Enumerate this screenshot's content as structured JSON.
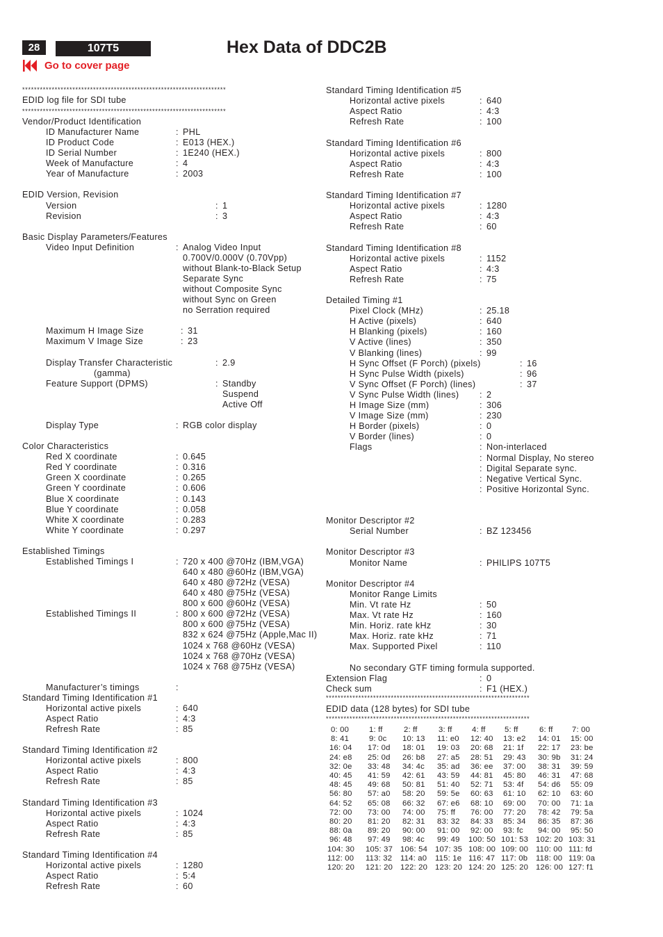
{
  "header": {
    "page_number": "28",
    "model": "107T5",
    "title": "Hex Data of DDC2B",
    "cover_link": "Go to cover page",
    "cover_icon": "rewind-to-start-icon",
    "accent_color": "#e31e24",
    "badge_color": "#231f20"
  },
  "divider": "*********************************************************************",
  "log_title": "EDID log file for SDI tube",
  "left_column": [
    {
      "type": "section",
      "text": "Vendor/Product Identification"
    },
    {
      "type": "field",
      "label": "ID Manufacturer Name",
      "value": "PHL"
    },
    {
      "type": "field",
      "label": "ID Product Code",
      "value": "E013 (HEX.)"
    },
    {
      "type": "field",
      "label": "ID Serial Number",
      "value": "1E240 (HEX.)"
    },
    {
      "type": "field",
      "label": "Week of Manufacture",
      "value": "4"
    },
    {
      "type": "field",
      "label": "Year of Manufacture",
      "value": "2003"
    },
    {
      "type": "blank"
    },
    {
      "type": "section",
      "text": "EDID Version, Revision"
    },
    {
      "type": "field",
      "label": "Version",
      "value": "1",
      "col": "wide"
    },
    {
      "type": "field",
      "label": "Revision",
      "value": "3",
      "col": "wide"
    },
    {
      "type": "blank"
    },
    {
      "type": "section",
      "text": "Basic Display Parameters/Features"
    },
    {
      "type": "field",
      "label": "Video Input Definition",
      "value": "Analog Video Input"
    },
    {
      "type": "cont",
      "value": "0.700V/0.000V (0.70Vpp)"
    },
    {
      "type": "cont",
      "value": "without Blank-to-Black Setup"
    },
    {
      "type": "cont",
      "value": "Separate Sync"
    },
    {
      "type": "cont",
      "value": "without Composite Sync"
    },
    {
      "type": "cont",
      "value": "without Sync on Green"
    },
    {
      "type": "cont",
      "value": "no Serration required"
    },
    {
      "type": "blank"
    },
    {
      "type": "field",
      "label": "Maximum H Image Size",
      "value": "31",
      "col": "mid"
    },
    {
      "type": "field",
      "label": "Maximum V Image Size",
      "value": "23",
      "col": "mid"
    },
    {
      "type": "blank"
    },
    {
      "type": "field",
      "label": "Display Transfer Characteristic",
      "value": "2.9",
      "col": "wide"
    },
    {
      "type": "sublabel",
      "text": "(gamma)"
    },
    {
      "type": "field",
      "label": "Feature Support (DPMS)",
      "value": "Standby",
      "col": "wide"
    },
    {
      "type": "cont",
      "value": "Suspend",
      "col": "wide"
    },
    {
      "type": "cont",
      "value": "Active Off",
      "col": "wide"
    },
    {
      "type": "blank"
    },
    {
      "type": "field",
      "label": "Display Type",
      "value": "RGB color display"
    },
    {
      "type": "blank"
    },
    {
      "type": "section",
      "text": "Color Characteristics"
    },
    {
      "type": "field",
      "label": "Red   X coordinate",
      "value": "0.645"
    },
    {
      "type": "field",
      "label": "Red   Y coordinate",
      "value": "0.316"
    },
    {
      "type": "field",
      "label": "Green X coordinate",
      "value": "0.265"
    },
    {
      "type": "field",
      "label": "Green Y coordinate",
      "value": "0.606"
    },
    {
      "type": "field",
      "label": "Blue  X coordinate",
      "value": "0.143"
    },
    {
      "type": "field",
      "label": "Blue  Y coordinate",
      "value": "0.058"
    },
    {
      "type": "field",
      "label": "White X coordinate",
      "value": "0.283"
    },
    {
      "type": "field",
      "label": "White Y coordinate",
      "value": "0.297"
    },
    {
      "type": "blank"
    },
    {
      "type": "section",
      "text": "Established Timings"
    },
    {
      "type": "field",
      "label": "Established Timings I",
      "value": "720 x 400 @70Hz (IBM,VGA)"
    },
    {
      "type": "cont",
      "value": "640 x 480 @60Hz (IBM,VGA)"
    },
    {
      "type": "cont",
      "value": "640 x 480 @72Hz (VESA)"
    },
    {
      "type": "cont",
      "value": "640 x 480 @75Hz (VESA)"
    },
    {
      "type": "cont",
      "value": "800 x 600 @60Hz (VESA)"
    },
    {
      "type": "field",
      "label": "Established Timings II",
      "value": "800 x 600 @72Hz (VESA)"
    },
    {
      "type": "cont",
      "value": "800 x 600 @75Hz (VESA)"
    },
    {
      "type": "cont",
      "value": "832 x 624 @75Hz (Apple,Mac II)"
    },
    {
      "type": "cont",
      "value": "1024 x 768 @60Hz (VESA)"
    },
    {
      "type": "cont",
      "value": "1024 x 768 @70Hz (VESA)"
    },
    {
      "type": "cont",
      "value": "1024 x 768 @75Hz (VESA)"
    },
    {
      "type": "blank"
    },
    {
      "type": "field",
      "label": "Manufacturer’s timings",
      "value": ""
    },
    {
      "type": "section",
      "text": "Standard Timing Identification #1"
    },
    {
      "type": "field",
      "label": "Horizontal active pixels",
      "value": "640"
    },
    {
      "type": "field",
      "label": "Aspect Ratio",
      "value": "4:3"
    },
    {
      "type": "field",
      "label": "Refresh Rate",
      "value": "85"
    },
    {
      "type": "blank"
    },
    {
      "type": "section",
      "text": "Standard Timing Identification #2"
    },
    {
      "type": "field",
      "label": "Horizontal active pixels",
      "value": "800"
    },
    {
      "type": "field",
      "label": "Aspect Ratio",
      "value": "4:3"
    },
    {
      "type": "field",
      "label": "Refresh Rate",
      "value": "85"
    },
    {
      "type": "blank"
    },
    {
      "type": "section",
      "text": "Standard Timing Identification #3"
    },
    {
      "type": "field",
      "label": "Horizontal active pixels",
      "value": "1024"
    },
    {
      "type": "field",
      "label": "Aspect Ratio",
      "value": "4:3"
    },
    {
      "type": "field",
      "label": "Refresh Rate",
      "value": "85"
    },
    {
      "type": "blank"
    },
    {
      "type": "section",
      "text": "Standard Timing Identification #4"
    },
    {
      "type": "field",
      "label": "Horizontal active pixels",
      "value": "1280"
    },
    {
      "type": "field",
      "label": "Aspect Ratio",
      "value": "5:4"
    },
    {
      "type": "field",
      "label": "Refresh Rate",
      "value": "60"
    }
  ],
  "right_column": [
    {
      "type": "section",
      "text": "Standard Timing Identification #5"
    },
    {
      "type": "field",
      "label": "Horizontal active pixels",
      "value": "640"
    },
    {
      "type": "field",
      "label": "Aspect Ratio",
      "value": "4:3"
    },
    {
      "type": "field",
      "label": "Refresh Rate",
      "value": "100"
    },
    {
      "type": "blank"
    },
    {
      "type": "section",
      "text": "Standard Timing Identification #6"
    },
    {
      "type": "field",
      "label": "Horizontal active pixels",
      "value": "800"
    },
    {
      "type": "field",
      "label": "Aspect Ratio",
      "value": "4:3"
    },
    {
      "type": "field",
      "label": "Refresh Rate",
      "value": "100"
    },
    {
      "type": "blank"
    },
    {
      "type": "section",
      "text": "Standard Timing Identification #7"
    },
    {
      "type": "field",
      "label": "Horizontal active pixels",
      "value": "1280"
    },
    {
      "type": "field",
      "label": "Aspect Ratio",
      "value": "4:3"
    },
    {
      "type": "field",
      "label": "Refresh Rate",
      "value": "60"
    },
    {
      "type": "blank"
    },
    {
      "type": "section",
      "text": "Standard Timing Identification #8"
    },
    {
      "type": "field",
      "label": "Horizontal active pixels",
      "value": "1152"
    },
    {
      "type": "field",
      "label": "Aspect Ratio",
      "value": "4:3"
    },
    {
      "type": "field",
      "label": "Refresh Rate",
      "value": "75"
    },
    {
      "type": "blank"
    },
    {
      "type": "section",
      "text": "Detailed Timing #1"
    },
    {
      "type": "field",
      "label": "Pixel Clock (MHz)",
      "value": "25.18"
    },
    {
      "type": "field",
      "label": "H Active (pixels)",
      "value": "640"
    },
    {
      "type": "field",
      "label": "H Blanking (pixels)",
      "value": "160"
    },
    {
      "type": "field",
      "label": "V Active (lines)",
      "value": "350"
    },
    {
      "type": "field",
      "label": "V Blanking (lines)",
      "value": "99"
    },
    {
      "type": "field",
      "label": "H Sync Offset (F Porch) (pixels)",
      "value": "16",
      "col": "wide"
    },
    {
      "type": "field",
      "label": "H Sync Pulse Width (pixels)",
      "value": "96",
      "col": "wide"
    },
    {
      "type": "field",
      "label": "V Sync Offset (F Porch) (lines)",
      "value": "37",
      "col": "wide"
    },
    {
      "type": "field",
      "label": "V Sync Pulse Width (lines)",
      "value": "2"
    },
    {
      "type": "field",
      "label": "H Image Size (mm)",
      "value": "306"
    },
    {
      "type": "field",
      "label": "V Image Size (mm)",
      "value": "230"
    },
    {
      "type": "field",
      "label": "H Border (pixels)",
      "value": "0"
    },
    {
      "type": "field",
      "label": "V Border (lines)",
      "value": "0"
    },
    {
      "type": "field",
      "label": "Flags",
      "value": "Non-interlaced"
    },
    {
      "type": "field",
      "label": "",
      "value": "Normal Display, No stereo"
    },
    {
      "type": "field",
      "label": "",
      "value": "Digital Separate sync."
    },
    {
      "type": "field",
      "label": "",
      "value": "Negative Vertical Sync."
    },
    {
      "type": "field",
      "label": "",
      "value": "Positive Horizontal Sync."
    },
    {
      "type": "blank"
    },
    {
      "type": "blank"
    },
    {
      "type": "section",
      "text": "Monitor Descriptor #2"
    },
    {
      "type": "field",
      "label": "Serial Number",
      "value": " BZ  123456"
    },
    {
      "type": "blank"
    },
    {
      "type": "section",
      "text": "Monitor Descriptor #3"
    },
    {
      "type": "field",
      "label": "Monitor Name",
      "value": "PHILIPS 107T5"
    },
    {
      "type": "blank"
    },
    {
      "type": "section",
      "text": "Monitor Descriptor #4"
    },
    {
      "type": "sub",
      "text": "Monitor Range Limits"
    },
    {
      "type": "field",
      "label": "Min. Vt rate Hz",
      "value": "50"
    },
    {
      "type": "field",
      "label": "Max. Vt rate Hz",
      "value": "160"
    },
    {
      "type": "field",
      "label": "Min. Horiz. rate kHz",
      "value": "30"
    },
    {
      "type": "field",
      "label": "Max. Horiz. rate kHz",
      "value": "71"
    },
    {
      "type": "field",
      "label": "Max. Supported Pixel",
      "value": "110"
    },
    {
      "type": "blank"
    },
    {
      "type": "sub",
      "text": "No secondary GTF timing formula supported."
    },
    {
      "type": "topfield",
      "label": "Extension Flag",
      "value": "0"
    },
    {
      "type": "topfield",
      "label": "Check sum",
      "value": "F1 (HEX.)"
    }
  ],
  "hex_title": "EDID data (128 bytes) for SDI tube",
  "hex_bytes": [
    "00",
    "ff",
    "ff",
    "ff",
    "ff",
    "ff",
    "ff",
    "00",
    "41",
    "0c",
    "13",
    "e0",
    "40",
    "e2",
    "01",
    "00",
    "04",
    "0d",
    "01",
    "03",
    "68",
    "1f",
    "17",
    "be",
    "e8",
    "0d",
    "b8",
    "a5",
    "51",
    "43",
    "9b",
    "24",
    "0e",
    "48",
    "4c",
    "ad",
    "ee",
    "00",
    "31",
    "59",
    "45",
    "59",
    "61",
    "59",
    "81",
    "80",
    "31",
    "68",
    "45",
    "68",
    "81",
    "40",
    "71",
    "4f",
    "d6",
    "09",
    "80",
    "a0",
    "20",
    "5e",
    "63",
    "10",
    "10",
    "60",
    "52",
    "08",
    "32",
    "e6",
    "10",
    "00",
    "00",
    "1a",
    "00",
    "00",
    "00",
    "ff",
    "00",
    "20",
    "42",
    "5a",
    "20",
    "20",
    "31",
    "32",
    "33",
    "34",
    "35",
    "36",
    "0a",
    "20",
    "00",
    "00",
    "00",
    "fc",
    "00",
    "50",
    "48",
    "49",
    "4c",
    "49",
    "50",
    "53",
    "20",
    "31",
    "30",
    "37",
    "54",
    "35",
    "00",
    "00",
    "00",
    "fd",
    "00",
    "32",
    "a0",
    "1e",
    "47",
    "0b",
    "00",
    "0a",
    "20",
    "20",
    "20",
    "20",
    "20",
    "20",
    "00",
    "f1"
  ]
}
